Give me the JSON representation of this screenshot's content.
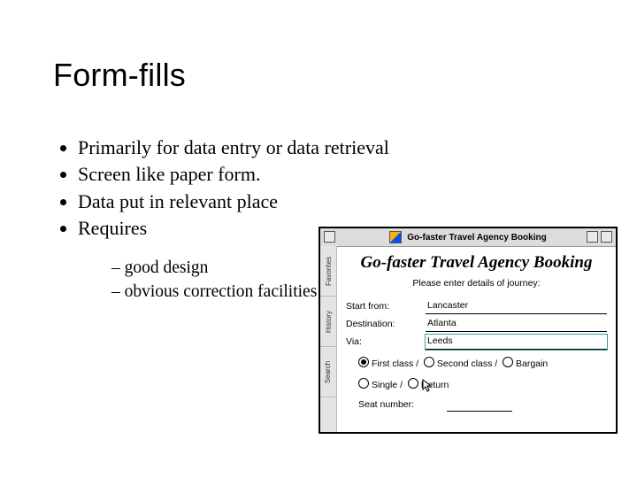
{
  "title": "Form-fills",
  "bullets": [
    "Primarily for data entry or data retrieval",
    "Screen like paper form.",
    "Data put in relevant place",
    "Requires"
  ],
  "subbullets": [
    "good design",
    "obvious correction facilities"
  ],
  "window": {
    "title": "Go-faster Travel Agency Booking",
    "tabs": [
      "Favorites",
      "History",
      "Search"
    ],
    "form": {
      "heading": "Go-faster Travel Agency Booking",
      "subtitle": "Please enter details of journey:",
      "fields": {
        "start_from": {
          "label": "Start from:",
          "value": "Lancaster"
        },
        "destination": {
          "label": "Destination:",
          "value": "Atlanta"
        },
        "via": {
          "label": "Via:",
          "value": "Leeds"
        }
      },
      "class_options": {
        "first": {
          "label": "First class",
          "selected": true
        },
        "second": {
          "label": "Second class",
          "selected": false
        },
        "bargain": {
          "label": "Bargain",
          "selected": false
        }
      },
      "trip_options": {
        "single": {
          "label": "Single",
          "selected": false
        },
        "return": {
          "label": "Return",
          "selected": false
        }
      },
      "seat": {
        "label": "Seat number:",
        "value": ""
      }
    }
  }
}
